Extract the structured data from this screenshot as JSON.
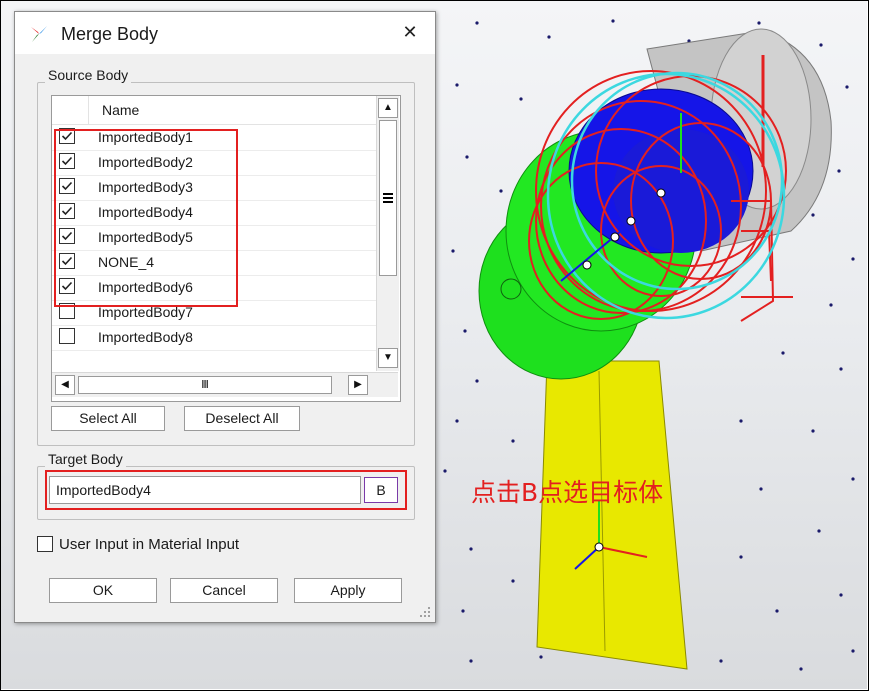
{
  "dialog": {
    "title": "Merge Body",
    "close_glyph": "✕",
    "source_group_label": "Source Body",
    "list_header_name": "Name",
    "items": [
      {
        "label": "ImportedBody1",
        "checked": true
      },
      {
        "label": "ImportedBody2",
        "checked": true
      },
      {
        "label": "ImportedBody3",
        "checked": true
      },
      {
        "label": "ImportedBody4",
        "checked": true
      },
      {
        "label": "ImportedBody5",
        "checked": true
      },
      {
        "label": "NONE_4",
        "checked": true
      },
      {
        "label": "ImportedBody6",
        "checked": true
      },
      {
        "label": "ImportedBody7",
        "checked": false
      },
      {
        "label": "ImportedBody8",
        "checked": false
      }
    ],
    "select_all_label": "Select All",
    "deselect_all_label": "Deselect All",
    "target_group_label": "Target Body",
    "target_value": "ImportedBody4",
    "target_pick_label": "B",
    "user_input_label": "User Input in Material Input",
    "user_input_checked": false,
    "ok_label": "OK",
    "cancel_label": "Cancel",
    "apply_label": "Apply"
  },
  "annotation": {
    "text": "点击B点选目标体",
    "color": "#e32020"
  },
  "colors": {
    "highlight_red": "#e32020",
    "body_green": "#1ee01e",
    "body_yellow": "#e8e800",
    "body_blue": "#1515e8",
    "body_gray": "#bdbdbd",
    "cyan_circle": "#3cd8e0"
  },
  "icons": {
    "app": "merge-body-app-icon",
    "scroll_up": "chevron-up-icon",
    "scroll_down": "chevron-down-icon",
    "scroll_left": "chevron-left-icon",
    "scroll_right": "chevron-right-icon"
  }
}
